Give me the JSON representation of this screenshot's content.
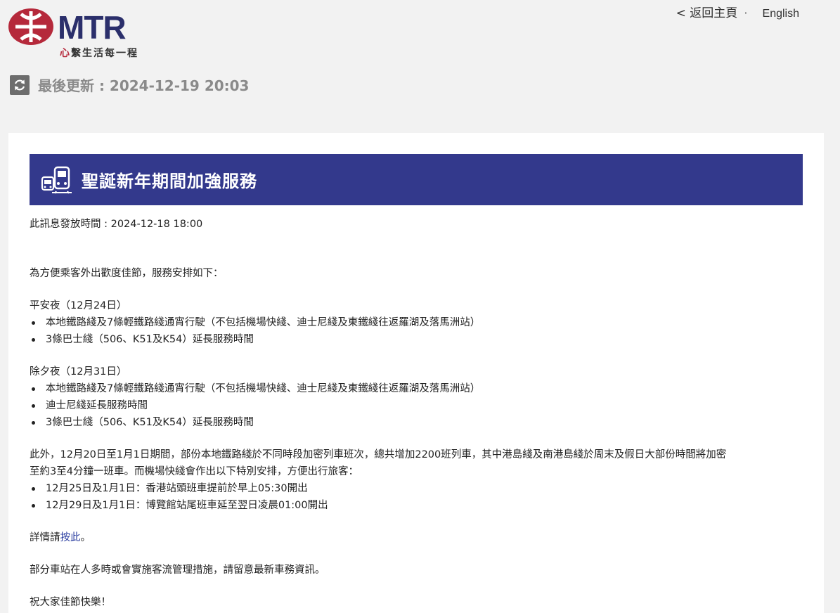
{
  "brand": {
    "name": "MTR",
    "slogan_first": "心",
    "slogan_rest": "繫生活每一程",
    "colors": {
      "red": "#b5293b",
      "navy": "#2b2f6b",
      "banner": "#33398c"
    }
  },
  "topnav": {
    "home_label": "< 返回主頁",
    "separator": "·",
    "lang_label": "English"
  },
  "status": {
    "icon": "refresh-icon",
    "last_updated": "最後更新 : 2024-12-19 20:03"
  },
  "notice": {
    "icon": "train-bus-icon",
    "title": "聖誕新年期間加強服務",
    "published": "此訊息發放時間 : 2024-12-18 18:00",
    "intro": "為方便乘客外出歡度佳節，服務安排如下：",
    "sections": [
      {
        "heading": "平安夜（12月24日）",
        "items": [
          "本地鐵路綫及7條輕鐵路綫通宵行駛（不包括機場快綫、迪士尼綫及東鐵綫往返羅湖及落馬洲站）",
          "3條巴士綫（506、K51及K54）延長服務時間"
        ]
      },
      {
        "heading": "除夕夜（12月31日）",
        "items": [
          "本地鐵路綫及7條輕鐵路綫通宵行駛（不包括機場快綫、迪士尼綫及東鐵綫往返羅湖及落馬洲站）",
          "迪士尼綫延長服務時間",
          "3條巴士綫（506、K51及K54）延長服務時間"
        ]
      }
    ],
    "extra_line1": "此外，12月20日至1月1日期間，部份本地鐵路綫於不同時段加密列車班次，總共增加2200班列車，其中港島綫及南港島綫於周末及假日大部份時間將加密",
    "extra_line2": "至約3至4分鐘一班車。而機場快綫會作出以下特別安排，方便出行旅客：",
    "extra_items": [
      "12月25日及1月1日：香港站頭班車提前於早上05:30開出",
      "12月29日及1月1日：博覽館站尾班車延至翌日凌晨01:00開出"
    ],
    "details_prefix": "詳情請",
    "details_link": "按此",
    "details_suffix": "。",
    "crowd_note": "部分車站在人多時或會實施客流管理措施，請留意最新車務資訊。",
    "greeting": "祝大家佳節快樂！"
  }
}
